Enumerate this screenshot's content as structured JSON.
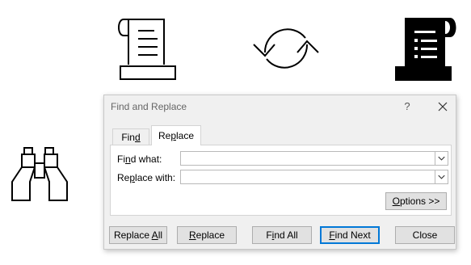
{
  "dialog": {
    "title": "Find and Replace",
    "help_label": "?",
    "tabs": [
      {
        "label_pre": "Fin",
        "label_acc": "d",
        "label_post": ""
      },
      {
        "label_pre": "Re",
        "label_acc": "p",
        "label_post": "lace"
      }
    ],
    "find_what": {
      "label_pre": "Fi",
      "label_acc": "n",
      "label_post": "d what:",
      "value": ""
    },
    "replace_with": {
      "label_pre": "Re",
      "label_acc": "p",
      "label_post": "lace with:",
      "value": ""
    },
    "options": {
      "label_pre": "",
      "label_acc": "O",
      "label_post": "ptions >>"
    },
    "buttons": {
      "replace_all": {
        "label_pre": "Replace ",
        "label_acc": "A",
        "label_post": "ll"
      },
      "replace": {
        "label_pre": "",
        "label_acc": "R",
        "label_post": "eplace"
      },
      "find_all": {
        "label_pre": "F",
        "label_acc": "i",
        "label_post": "nd All"
      },
      "find_next": {
        "label_pre": "",
        "label_acc": "F",
        "label_post": "ind Next"
      },
      "close": {
        "label_pre": "Close",
        "label_acc": "",
        "label_post": ""
      }
    }
  },
  "icons": [
    "scroll-outline-icon",
    "refresh-icon",
    "scroll-filled-icon",
    "binoculars-icon"
  ]
}
